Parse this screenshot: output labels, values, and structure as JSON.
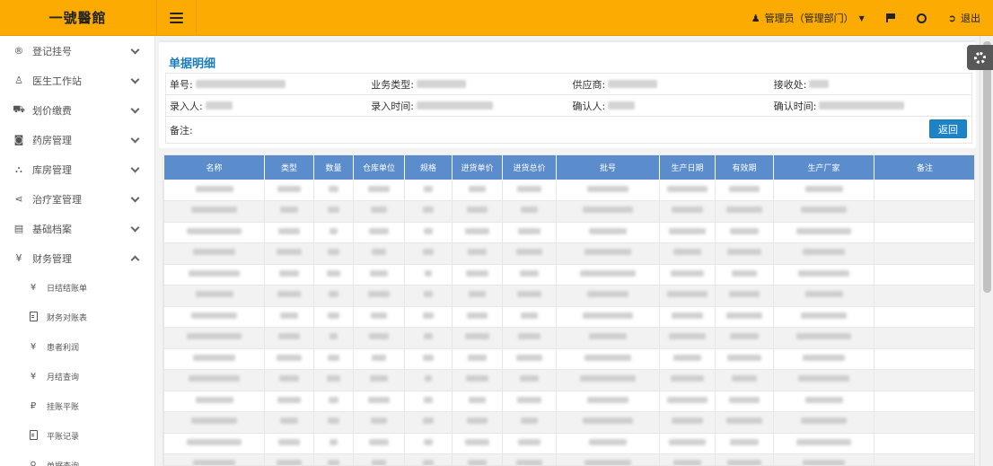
{
  "brand": "一號醫館",
  "topbar": {
    "user_label": "管理员（管理部门）",
    "logout_label": "退出"
  },
  "sidebar": {
    "items": [
      {
        "label": "登记挂号",
        "icon": "registered-icon",
        "glyph": "®"
      },
      {
        "label": "医生工作站",
        "icon": "user-md-icon",
        "glyph": "♙"
      },
      {
        "label": "划价缴费",
        "icon": "cart-icon",
        "glyph": "⛟"
      },
      {
        "label": "药房管理",
        "icon": "save-icon",
        "glyph": "◙"
      },
      {
        "label": "库房管理",
        "icon": "cubes-icon",
        "glyph": "⛬"
      },
      {
        "label": "治疗室管理",
        "icon": "share-icon",
        "glyph": "⋖"
      },
      {
        "label": "基础档案",
        "icon": "book-icon",
        "glyph": "▤"
      },
      {
        "label": "财务管理",
        "icon": "yen-icon",
        "glyph": "¥"
      }
    ],
    "sub_items": [
      {
        "label": "日结结账单",
        "icon": "yen-icon",
        "glyph": "¥"
      },
      {
        "label": "财务对账表",
        "icon": "file-icon",
        "glyph": ""
      },
      {
        "label": "患者利润",
        "icon": "yen-icon",
        "glyph": "¥"
      },
      {
        "label": "月结查询",
        "icon": "yen-icon",
        "glyph": "¥"
      },
      {
        "label": "挂账平账",
        "icon": "ruble-icon",
        "glyph": "₽"
      },
      {
        "label": "平账记录",
        "icon": "file-icon",
        "glyph": ""
      },
      {
        "label": "单据查询",
        "icon": "search-icon",
        "glyph": "⚲"
      }
    ]
  },
  "panel": {
    "title": "单据明细",
    "fields": {
      "doc_no": "单号:",
      "biz_type": "业务类型:",
      "supplier": "供应商:",
      "receiver": "接收处:",
      "entered_by": "录入人:",
      "entered_time": "录入时间:",
      "confirmed_by": "确认人:",
      "confirmed_time": "确认时间:",
      "note": "备注:"
    },
    "back_label": "返回"
  },
  "table": {
    "headers": [
      "名称",
      "类型",
      "数量",
      "仓库单位",
      "规格",
      "进货单价",
      "进货总价",
      "批号",
      "生产日期",
      "有效期",
      "生产厂家",
      "备注"
    ],
    "rows": [
      [
        "",
        "",
        "",
        "",
        "",
        "",
        "",
        "",
        "",
        "",
        "",
        ""
      ],
      [
        "",
        "",
        "",
        "",
        "",
        "",
        "",
        "",
        "",
        "",
        "",
        ""
      ],
      [
        "",
        "",
        "",
        "",
        "",
        "",
        "",
        "",
        "",
        "",
        "",
        ""
      ],
      [
        "",
        "",
        "",
        "",
        "",
        "",
        "",
        "",
        "",
        "",
        "",
        ""
      ],
      [
        "",
        "",
        "",
        "",
        "",
        "",
        "",
        "",
        "",
        "",
        "",
        ""
      ],
      [
        "",
        "",
        "",
        "",
        "",
        "",
        "",
        "",
        "",
        "",
        "",
        ""
      ],
      [
        "",
        "",
        "",
        "",
        "",
        "",
        "",
        "",
        "",
        "",
        "",
        ""
      ],
      [
        "",
        "",
        "",
        "",
        "",
        "",
        "",
        "",
        "",
        "",
        "",
        ""
      ],
      [
        "",
        "",
        "",
        "",
        "",
        "",
        "",
        "",
        "",
        "",
        "",
        ""
      ],
      [
        "",
        "",
        "",
        "",
        "",
        "",
        "",
        "",
        "",
        "",
        "",
        ""
      ],
      [
        "",
        "",
        "",
        "",
        "",
        "",
        "",
        "",
        "",
        "",
        "",
        ""
      ],
      [
        "",
        "",
        "",
        "",
        "",
        "",
        "",
        "",
        "",
        "",
        "",
        ""
      ],
      [
        "",
        "",
        "",
        "",
        "",
        "",
        "",
        "",
        "",
        "",
        "",
        ""
      ],
      [
        "",
        "",
        "",
        "",
        "",
        "",
        "",
        "",
        "",
        "",
        "",
        ""
      ]
    ]
  },
  "colors": {
    "topbar": "#fbab01",
    "table_header": "#5b8ccb",
    "title_blue": "#1a7bb9",
    "button_blue": "#1c84c6"
  }
}
